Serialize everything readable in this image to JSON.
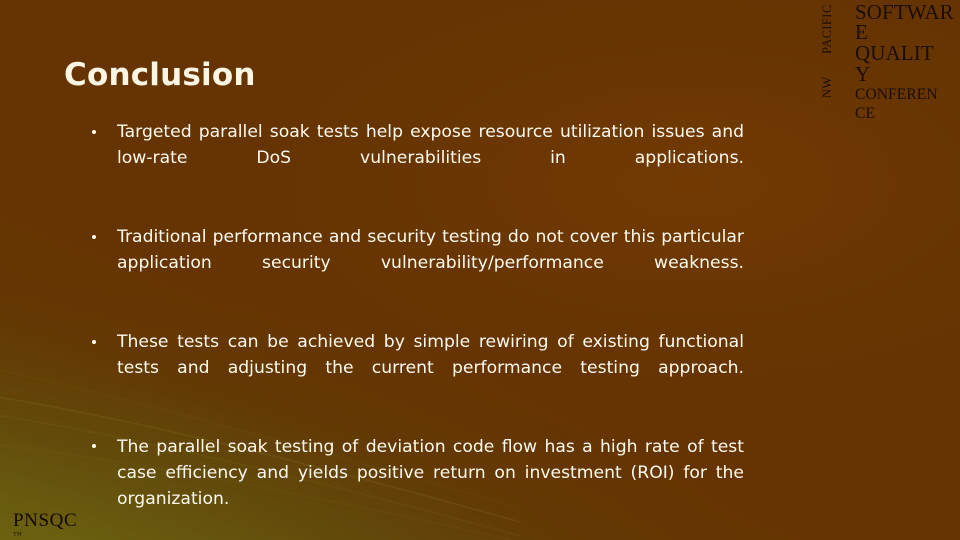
{
  "slide": {
    "title": "Conclusion",
    "bullets": [
      "Targeted parallel soak tests help expose resource utilization issues and low-rate DoS vulnerabilities in applications.",
      "Traditional performance and security testing do not cover this particular application security vulnerability/performance weakness.",
      "These tests can be achieved by simple rewiring of existing functional tests and adjusting the current performance testing approach.",
      "The parallel soak testing of deviation code flow has a high rate of test case efficiency and yields positive return on investment (ROI) for the organization."
    ]
  },
  "logo": {
    "vertical_top": "PACIFIC",
    "vertical_bottom": "NW",
    "line1": "SOFTWAR",
    "line2": "E",
    "line3": "QUALIT",
    "line4": "Y",
    "line5": "CONFEREN",
    "line6": "CE"
  },
  "footer": {
    "wordmark": "PNSQC",
    "wordmark_sub": "™"
  },
  "colors": {
    "background_brown": "#653402",
    "background_olive": "#6e6a12",
    "title_text": "#fdf6e4",
    "body_text": "#fffaf0",
    "logo_text": "#1a0d03"
  }
}
